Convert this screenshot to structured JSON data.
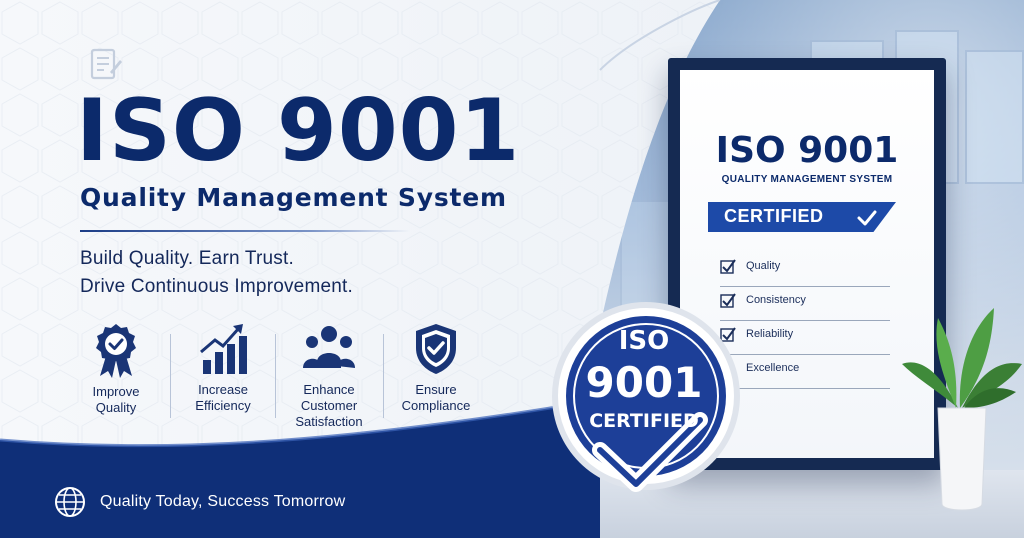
{
  "headline": {
    "title": "ISO 9001",
    "subtitle": "Quality Management System"
  },
  "tagline": {
    "line1": "Build Quality. Earn Trust.",
    "line2": "Drive Continuous Improvement."
  },
  "benefits": [
    {
      "icon": "award-ribbon-icon",
      "line1": "Improve",
      "line2": "Quality",
      "line3": ""
    },
    {
      "icon": "growth-chart-icon",
      "line1": "Increase",
      "line2": "Efficiency",
      "line3": ""
    },
    {
      "icon": "customers-group-icon",
      "line1": "Enhance",
      "line2": "Customer",
      "line3": "Satisfaction"
    },
    {
      "icon": "shield-check-icon",
      "line1": "Ensure",
      "line2": "Compliance",
      "line3": ""
    }
  ],
  "footer": {
    "icon": "globe-icon",
    "text": "Quality Today, Success Tomorrow"
  },
  "certificate": {
    "title": "ISO 9001",
    "subtitle": "QUALITY MANAGEMENT SYSTEM",
    "banner": "CERTIFIED",
    "items": [
      {
        "label": "Quality",
        "checked": true
      },
      {
        "label": "Consistency",
        "checked": true
      },
      {
        "label": "Reliability",
        "checked": true
      },
      {
        "label": "Excellence",
        "checked": false
      }
    ]
  },
  "seal": {
    "line1": "ISO",
    "line2": "9001",
    "line3": "CERTIFIED"
  },
  "colors": {
    "navy": "#0c2a6b",
    "brand_blue": "#1d4aa8",
    "footer_band": "#0f2f78"
  }
}
